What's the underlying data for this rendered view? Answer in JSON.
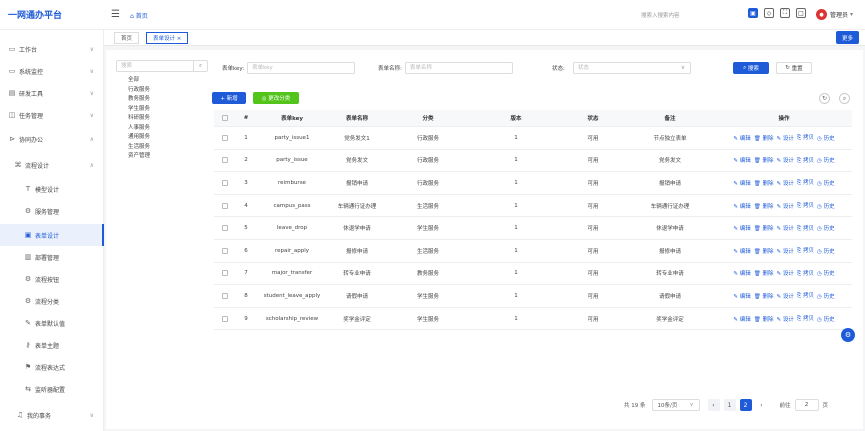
{
  "app_title": "一网通办平台",
  "header": {
    "breadcrumb": "首页",
    "search_placeholder": "搜索入搜索内容",
    "user_name": "管理员"
  },
  "sidebar": {
    "items": [
      {
        "label": "工作台",
        "icon": "monitor-icon",
        "chevron": "∨"
      },
      {
        "label": "系统监控",
        "icon": "monitor-icon",
        "chevron": "∨"
      },
      {
        "label": "研发工具",
        "icon": "tool-icon",
        "chevron": "∨"
      },
      {
        "label": "任务管理",
        "icon": "task-icon",
        "chevron": "∨"
      },
      {
        "label": "协同办公",
        "icon": "collab-icon",
        "chevron": "∧"
      },
      {
        "label": "流程设计",
        "icon": "flow-icon",
        "chevron": "∧"
      },
      {
        "label": "模型设计",
        "icon": "model-icon"
      },
      {
        "label": "服务管理",
        "icon": "gear-icon"
      },
      {
        "label": "表单设计",
        "icon": "form-icon",
        "active": true
      },
      {
        "label": "部署管理",
        "icon": "chart-icon"
      },
      {
        "label": "流程按钮",
        "icon": "gear-icon"
      },
      {
        "label": "流程分类",
        "icon": "gear-icon"
      },
      {
        "label": "表单默认值",
        "icon": "edit-icon"
      },
      {
        "label": "表单主题",
        "icon": "key-icon"
      },
      {
        "label": "流程表达式",
        "icon": "flag-icon"
      },
      {
        "label": "监听器配置",
        "icon": "link-icon"
      },
      {
        "label": "我的事务",
        "icon": "bell-icon",
        "chevron": "∨"
      }
    ]
  },
  "tabs": [
    {
      "label": "首页"
    },
    {
      "label": "表单设计 ×",
      "active": true
    }
  ],
  "more_label": "更多",
  "categories": {
    "search_placeholder": "搜索",
    "items": [
      "全部",
      "行政服务",
      "教务服务",
      "学生服务",
      "科研服务",
      "人事服务",
      "通用服务",
      "生活服务",
      "资产管理"
    ]
  },
  "filters": {
    "key_label": "表单key:",
    "key_placeholder": "表单key",
    "name_label": "表单名称:",
    "name_placeholder": "表单名称",
    "status_label": "状态:",
    "status_placeholder": "状态",
    "search_btn": "搜索",
    "reset_btn": "重置"
  },
  "actions": {
    "add": "+ 新增",
    "change_category": "◎ 更改分类"
  },
  "table": {
    "headers": [
      "#",
      "表单key",
      "表单名称",
      "分类",
      "版本",
      "状态",
      "备注",
      "操作"
    ],
    "op_labels": [
      "编辑",
      "删除",
      "设计",
      "拷贝",
      "历史"
    ],
    "rows": [
      {
        "no": "1",
        "key": "party_issue1",
        "name": "党务发文1",
        "category": "行政服务",
        "version": "1",
        "status": "可用",
        "remark": "节点独立表单"
      },
      {
        "no": "2",
        "key": "party_issue",
        "name": "党务发文",
        "category": "行政服务",
        "version": "1",
        "status": "可用",
        "remark": "党务发文"
      },
      {
        "no": "3",
        "key": "reimburse",
        "name": "报销申请",
        "category": "行政服务",
        "version": "1",
        "status": "可用",
        "remark": "报销申请"
      },
      {
        "no": "4",
        "key": "campus_pass",
        "name": "车辆通行证办理",
        "category": "生活服务",
        "version": "1",
        "status": "可用",
        "remark": "车辆通行证办理"
      },
      {
        "no": "5",
        "key": "leave_drop",
        "name": "休退学申请",
        "category": "学生服务",
        "version": "1",
        "status": "可用",
        "remark": "休退学申请"
      },
      {
        "no": "6",
        "key": "repair_apply",
        "name": "报修申请",
        "category": "生活服务",
        "version": "1",
        "status": "可用",
        "remark": "报修申请"
      },
      {
        "no": "7",
        "key": "major_transfer",
        "name": "转专业申请",
        "category": "教务服务",
        "version": "1",
        "status": "可用",
        "remark": "转专业申请"
      },
      {
        "no": "8",
        "key": "student_leave_apply",
        "name": "请假申请",
        "category": "学生服务",
        "version": "1",
        "status": "可用",
        "remark": "请假申请"
      },
      {
        "no": "9",
        "key": "scholarship_review",
        "name": "奖学金评定",
        "category": "学生服务",
        "version": "1",
        "status": "可用",
        "remark": "奖学金评定"
      }
    ]
  },
  "pagination": {
    "total": "共 19 条",
    "page_size": "10条/页",
    "pages": [
      "1",
      "2"
    ],
    "current": "2",
    "goto_label": "前往",
    "goto_value": "2",
    "page_suffix": "页"
  },
  "colors": {
    "accent": "#1f5bd8",
    "green": "#52c41a"
  }
}
